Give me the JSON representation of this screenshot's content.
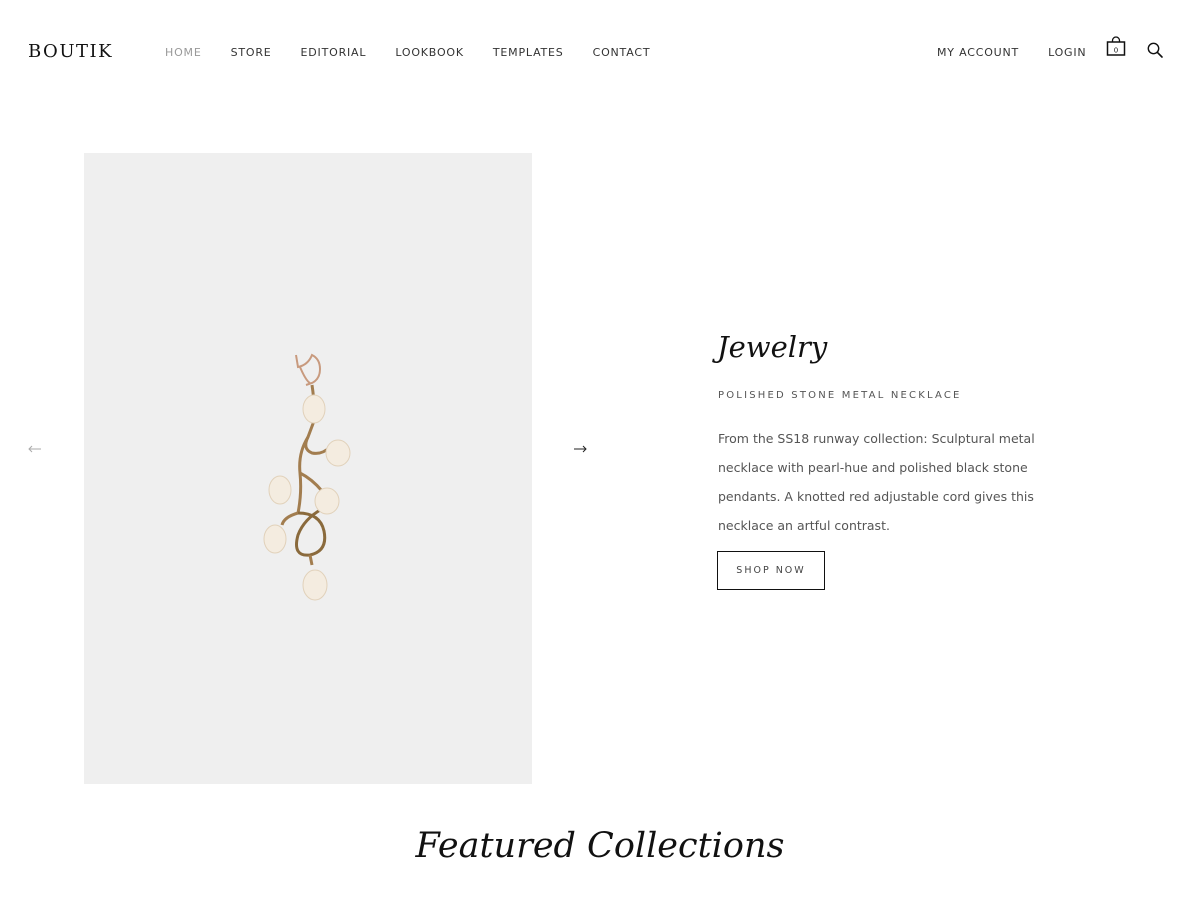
{
  "header": {
    "logo": "BOUTIK",
    "nav": [
      "HOME",
      "STORE",
      "EDITORIAL",
      "LOOKBOOK",
      "TEMPLATES",
      "CONTACT"
    ],
    "nav_right": [
      "MY ACCOUNT",
      "LOGIN"
    ],
    "icons": [
      "shopping-bag-icon",
      "search-icon"
    ]
  },
  "slider": {
    "title": "Jewelry",
    "subtitle": "POLISHED STONE METAL NECKLACE",
    "description": "From the SS18 runway collection: Sculptural metal necklace with pearl-hue and polished black stone pendants. A knotted red adjustable cord gives this necklace an artful contrast.",
    "button_label": "SHOP NOW",
    "icons": [
      "arrow-left-icon",
      "arrow-right-icon"
    ]
  },
  "section": {
    "heading": "Featured Collections"
  },
  "colors": {
    "image_background": "#efefef",
    "text": "#222222",
    "muted": "#999999"
  }
}
